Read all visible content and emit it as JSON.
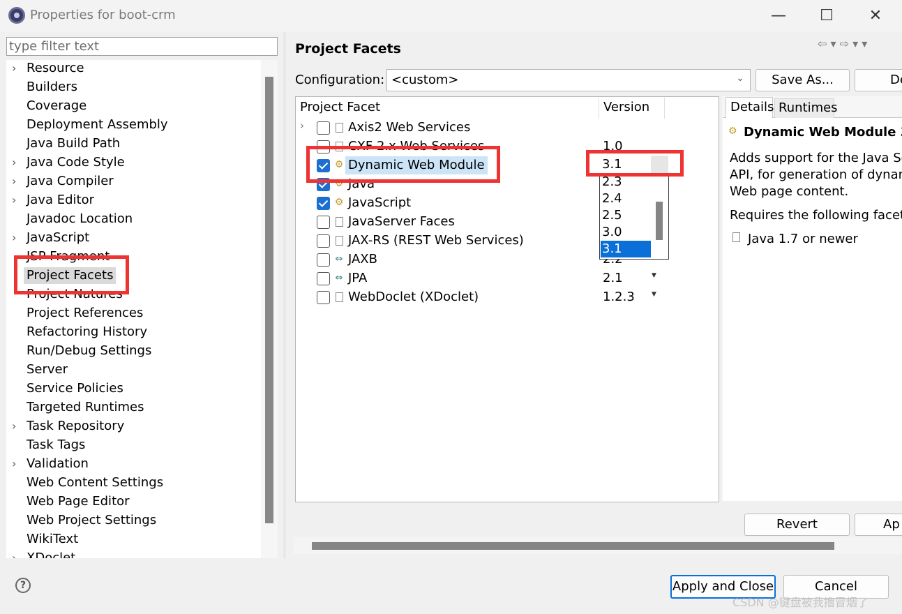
{
  "window": {
    "title": "Properties for boot-crm",
    "minimize": "—",
    "maximize": "☐",
    "close": "✕"
  },
  "left": {
    "filter_placeholder": "type filter text",
    "items": [
      {
        "label": "Resource",
        "expandable": true
      },
      {
        "label": "Builders",
        "expandable": false
      },
      {
        "label": "Coverage",
        "expandable": false
      },
      {
        "label": "Deployment Assembly",
        "expandable": false
      },
      {
        "label": "Java Build Path",
        "expandable": false
      },
      {
        "label": "Java Code Style",
        "expandable": true
      },
      {
        "label": "Java Compiler",
        "expandable": true
      },
      {
        "label": "Java Editor",
        "expandable": true
      },
      {
        "label": "Javadoc Location",
        "expandable": false
      },
      {
        "label": "JavaScript",
        "expandable": true
      },
      {
        "label": "JSP Fragment",
        "expandable": false
      },
      {
        "label": "Project Facets",
        "expandable": false,
        "selected": true
      },
      {
        "label": "Project Natures",
        "expandable": false
      },
      {
        "label": "Project References",
        "expandable": false
      },
      {
        "label": "Refactoring History",
        "expandable": false
      },
      {
        "label": "Run/Debug Settings",
        "expandable": false
      },
      {
        "label": "Server",
        "expandable": false
      },
      {
        "label": "Service Policies",
        "expandable": false
      },
      {
        "label": "Targeted Runtimes",
        "expandable": false
      },
      {
        "label": "Task Repository",
        "expandable": true
      },
      {
        "label": "Task Tags",
        "expandable": false
      },
      {
        "label": "Validation",
        "expandable": true
      },
      {
        "label": "Web Content Settings",
        "expandable": false
      },
      {
        "label": "Web Page Editor",
        "expandable": false
      },
      {
        "label": "Web Project Settings",
        "expandable": false
      },
      {
        "label": "WikiText",
        "expandable": false
      },
      {
        "label": "XDoclet",
        "expandable": true
      }
    ]
  },
  "right": {
    "page_title": "Project Facets",
    "nav_icons": "⇦ ▾  ⇨ ▾  ▾",
    "configuration_label": "Configuration:",
    "configuration_value": "<custom>",
    "save_as": "Save As...",
    "delete": "De",
    "col_facet": "Project Facet",
    "col_version": "Version",
    "facets": [
      {
        "label": "Axis2 Web Services",
        "checked": false,
        "icon": "doc",
        "expandable": true,
        "version": "",
        "dropdown": false
      },
      {
        "label": "CXF 2.x Web Services",
        "checked": false,
        "icon": "doc",
        "expandable": false,
        "version": "1.0",
        "dropdown": false
      },
      {
        "label": "Dynamic Web Module",
        "checked": true,
        "icon": "gear",
        "expandable": false,
        "version": "",
        "dropdown": false,
        "selected": true
      },
      {
        "label": "Java",
        "checked": true,
        "icon": "gear",
        "expandable": false,
        "version": "",
        "dropdown": false
      },
      {
        "label": "JavaScript",
        "checked": true,
        "icon": "gear",
        "expandable": false,
        "version": "",
        "dropdown": false
      },
      {
        "label": "JavaServer Faces",
        "checked": false,
        "icon": "doc",
        "expandable": false,
        "version": "",
        "dropdown": false
      },
      {
        "label": "JAX-RS (REST Web Services)",
        "checked": false,
        "icon": "doc",
        "expandable": false,
        "version": "",
        "dropdown": false
      },
      {
        "label": "JAXB",
        "checked": false,
        "icon": "arrow",
        "expandable": false,
        "version": "2.2",
        "dropdown": true
      },
      {
        "label": "JPA",
        "checked": false,
        "icon": "arrow",
        "expandable": false,
        "version": "2.1",
        "dropdown": true
      },
      {
        "label": "WebDoclet (XDoclet)",
        "checked": false,
        "icon": "doc",
        "expandable": false,
        "version": "1.2.3",
        "dropdown": true
      }
    ],
    "version_current": "3.1",
    "version_options": [
      "2.3",
      "2.4",
      "2.5",
      "3.0",
      "3.1"
    ],
    "version_selected_index": 4,
    "tab_details": "Details",
    "tab_runtimes": "Runtimes",
    "details_title": "Dynamic Web Module 3.",
    "details_lines": [
      "Adds support for the Java Se",
      "API, for generation of dynan",
      "Web page content."
    ],
    "requires_label": "Requires the following facet",
    "requires_item": "Java 1.7 or newer",
    "revert": "Revert",
    "apply": "Ap"
  },
  "bottom": {
    "help": "?",
    "apply_and_close": "Apply and Close",
    "cancel": "Cancel",
    "watermark": "CSDN @键盘被我撸冒烟了"
  },
  "colors": {
    "accent": "#0a6fd6",
    "annotation_red": "#ee3333",
    "selection_light": "#cce4f7"
  }
}
